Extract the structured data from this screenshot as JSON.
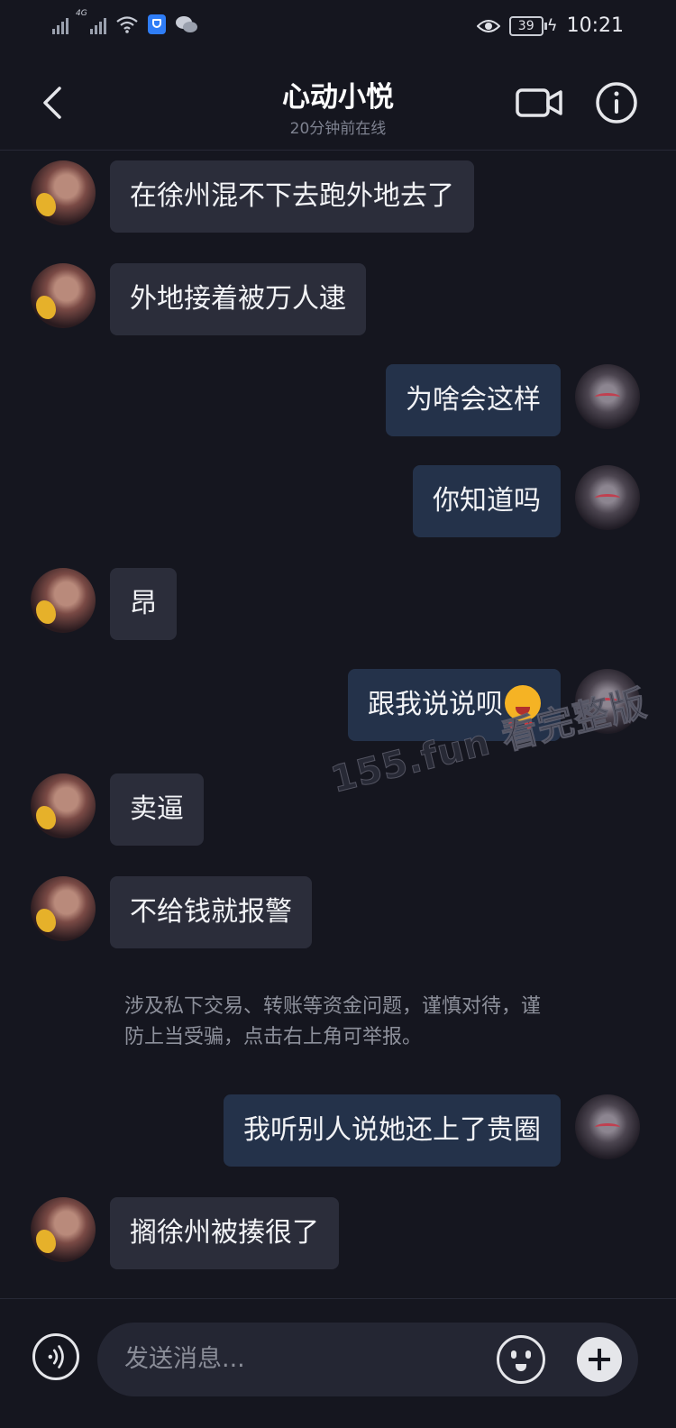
{
  "status_bar": {
    "time": "10:21",
    "battery": "39",
    "network": "4G"
  },
  "header": {
    "title": "心动小悦",
    "subtitle": "20分钟前在线"
  },
  "messages": [
    {
      "side": "left",
      "text": "在徐州混不下去跑外地去了"
    },
    {
      "side": "left",
      "text": "外地接着被万人逮"
    },
    {
      "side": "right",
      "text": "为啥会这样"
    },
    {
      "side": "right",
      "text": "你知道吗"
    },
    {
      "side": "left",
      "text": "昂"
    },
    {
      "side": "right",
      "text": "跟我说说呗",
      "emoji": "heart-eyes-emoji"
    },
    {
      "side": "left",
      "text": "卖逼"
    },
    {
      "side": "left",
      "text": "不给钱就报警"
    },
    {
      "side": "right",
      "text": "我听别人说她还上了贵圈"
    },
    {
      "side": "left",
      "text": "搁徐州被揍很了"
    }
  ],
  "notice": "涉及私下交易、转账等资金问题，谨慎对待，谨防上当受骗，点击右上角可举报。",
  "watermark": "155.fun 看完整版",
  "input": {
    "placeholder": "发送消息..."
  },
  "colors": {
    "background": "#15161f",
    "bubble_other": "#2b2d3a",
    "bubble_self": "#24324a"
  }
}
